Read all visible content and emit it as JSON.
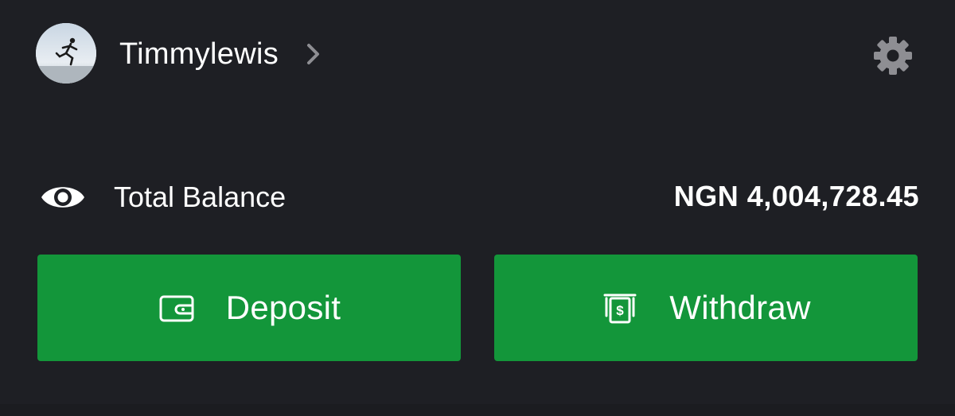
{
  "profile": {
    "username": "Timmylewis",
    "avatar_icon": "runner-photo-avatar",
    "chevron_icon": "chevron-right-icon",
    "settings_icon": "gear-icon"
  },
  "balance": {
    "visibility_icon": "eye-icon",
    "label": "Total Balance",
    "amount": "NGN 4,004,728.45"
  },
  "actions": {
    "deposit": {
      "label": "Deposit",
      "icon": "wallet-icon"
    },
    "withdraw": {
      "label": "Withdraw",
      "icon": "atm-cash-icon"
    }
  },
  "colors": {
    "background": "#1e1f24",
    "button_green": "#13963a",
    "text": "#ffffff",
    "icon_grey": "#8e8e93"
  }
}
